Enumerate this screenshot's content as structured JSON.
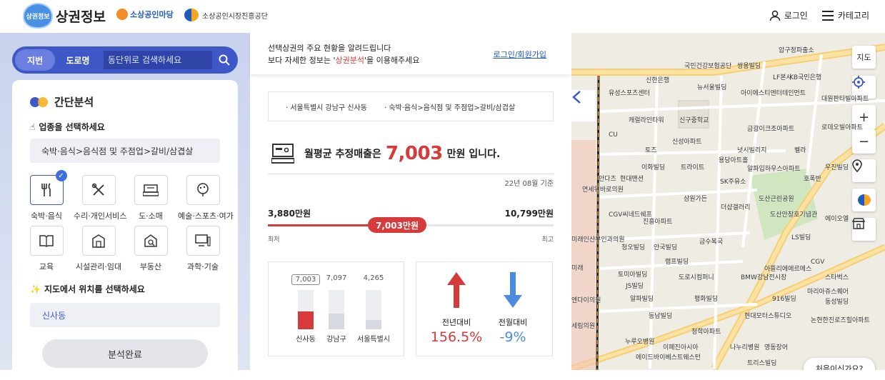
{
  "header": {
    "logo_badge": "상권정보",
    "logo_text": "상권정보",
    "partner1": "소상공인마당",
    "partner2": "소상공인시장진흥공단",
    "login_label": "로그인",
    "category_label": "카테고리"
  },
  "search": {
    "tab_lot": "지번",
    "tab_road": "도로명",
    "placeholder": "동단위로 검색하세요"
  },
  "quick": {
    "title": "간단분석",
    "step1": "업종을 선택하세요",
    "selected_industry": "숙박·음식>음식점 및 주점업>갈비/삼겹살",
    "categories": [
      {
        "label": "숙박·음식",
        "icon": "fork-knife-icon"
      },
      {
        "label": "수리·개인서비스",
        "icon": "tools-icon"
      },
      {
        "label": "도·소매",
        "icon": "cash-register-icon"
      },
      {
        "label": "예술·스포츠·여가",
        "icon": "palette-icon"
      },
      {
        "label": "교육",
        "icon": "book-icon"
      },
      {
        "label": "시설관리·임대",
        "icon": "building-icon"
      },
      {
        "label": "부동산",
        "icon": "house-search-icon"
      },
      {
        "label": "과학·기술",
        "icon": "computer-icon"
      }
    ],
    "step2": "지도에서 위치를 선택하세요",
    "selected_region": "신사동",
    "submit": "분석완료"
  },
  "notice": {
    "line1": "선택상권의 주요 현황을 알려드립니다",
    "line2_pre": "보다 자세한 정보는 '",
    "line2_hl": "상권분석",
    "line2_post": "'을 이용해주세요",
    "login_join": "로그인/회원가입"
  },
  "crumbs": {
    "region": "· 서울특별시 강남구 신사동",
    "industry": "· 숙박·음식>음식점 및 주점업>갈비/삼겹살"
  },
  "sales": {
    "prefix": "월평균 추정매출은",
    "amount": "7,003",
    "suffix": "만원 입니다.",
    "basis": "22년 08월 기준"
  },
  "range": {
    "min_label": "3,880만원",
    "max_label": "10,799만원",
    "current_label": "7,003만원",
    "min": 3880,
    "max": 10799,
    "current": 7003,
    "low_text": "최저",
    "high_text": "최고"
  },
  "chart_data": {
    "type": "bar",
    "categories": [
      "신사동",
      "강남구",
      "서울특별시"
    ],
    "values": [
      7003,
      7097,
      4265
    ],
    "value_labels": [
      "7,003",
      "7,097",
      "4,265"
    ],
    "colors": [
      "#d63a3a",
      "#d7d9e0",
      "#d7d9e0"
    ]
  },
  "change": {
    "yoy_label": "전년대비",
    "yoy_value": "156.5%",
    "yoy_color": "#d63a3a",
    "mom_label": "전월대비",
    "mom_value": "-9%",
    "mom_color": "#4a8de0"
  },
  "map": {
    "controls": [
      "지도"
    ],
    "first_visit": "처음이신가요?",
    "labels": [
      "압구정파출소",
      "국민건강보험공단",
      "쌍용빌딩",
      "LF본사",
      "KB국민은행",
      "신한은행",
      "뉴서울빌딩",
      "유성스포츠센터",
      "아이에스티엔터테인먼트",
      "대원판타빌아파트",
      "신구중학교",
      "캐럴라인타워",
      "금광이크조아파트",
      "로데오빌아파트",
      "CU",
      "토즈",
      "신성아파트",
      "넛시빌리지",
      "벨라",
      "이화빌딩",
      "트라이트",
      "용당아트홀",
      "알파입하우스아파트",
      "우진빌딩",
      "안다즈",
      "현대맨션",
      "SK주유소",
      "호폭반",
      "삼원가든",
      "도산근린공원",
      "더샵갤러리",
      "도산안창호기념관",
      "CGV씨네드쉐프",
      "진흥아파트",
      "에이오엘",
      "금수복국",
      "LS빌딩",
      "청오빌딩",
      "안국빌딩",
      "램프빌딩",
      "아뜰리에에르메스",
      "CGV",
      "토미아빌딩",
      "도로시컴퍼니",
      "BMW강남전시장",
      "스타벅스",
      "JS빌딩",
      "알파빌딩",
      "마리아쥬스퀘어",
      "916빌딩",
      "동성빌딩",
      "평화빌딩",
      "현대모터스튜디오",
      "논현한진로즈힐아파트",
      "동남빌딩",
      "청학아파트",
      "누루오병원",
      "나누리병원",
      "영동장어",
      "이페진아시아",
      "에이드바이베스트웨스턴",
      "트리스빌딩",
      "세림의원",
      "엔다이의원",
      "연세위바로의원",
      "미래인산부인과의원",
      "미래"
    ]
  }
}
